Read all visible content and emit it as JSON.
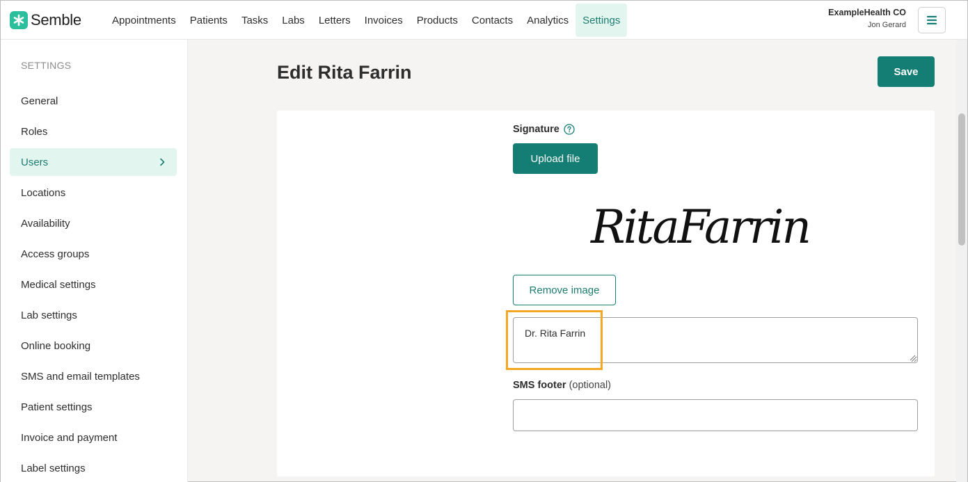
{
  "app": {
    "name": "Semble",
    "brand_color": "#2bbf9d",
    "accent_color": "#147d74"
  },
  "nav": {
    "items": [
      {
        "label": "Appointments"
      },
      {
        "label": "Patients"
      },
      {
        "label": "Tasks"
      },
      {
        "label": "Labs"
      },
      {
        "label": "Letters"
      },
      {
        "label": "Invoices"
      },
      {
        "label": "Products"
      },
      {
        "label": "Contacts"
      },
      {
        "label": "Analytics"
      },
      {
        "label": "Settings",
        "active": true
      }
    ]
  },
  "account": {
    "org": "ExampleHealth CO",
    "user": "Jon Gerard",
    "menu_icon": "hamburger-icon"
  },
  "sidebar": {
    "heading": "SETTINGS",
    "items": [
      {
        "label": "General"
      },
      {
        "label": "Roles"
      },
      {
        "label": "Users",
        "active": true
      },
      {
        "label": "Locations"
      },
      {
        "label": "Availability"
      },
      {
        "label": "Access groups"
      },
      {
        "label": "Medical settings"
      },
      {
        "label": "Lab settings"
      },
      {
        "label": "Online booking"
      },
      {
        "label": "SMS and email templates"
      },
      {
        "label": "Patient settings"
      },
      {
        "label": "Invoice and payment"
      },
      {
        "label": "Label settings"
      }
    ]
  },
  "main": {
    "title": "Edit Rita Farrin",
    "save_label": "Save",
    "signature": {
      "label": "Signature",
      "upload_label": "Upload file",
      "image_text": "RitaFarrin",
      "remove_label": "Remove image",
      "text_value": "Dr. Rita Farrin"
    },
    "sms_footer": {
      "label": "SMS footer",
      "optional": "(optional)",
      "value": ""
    }
  }
}
